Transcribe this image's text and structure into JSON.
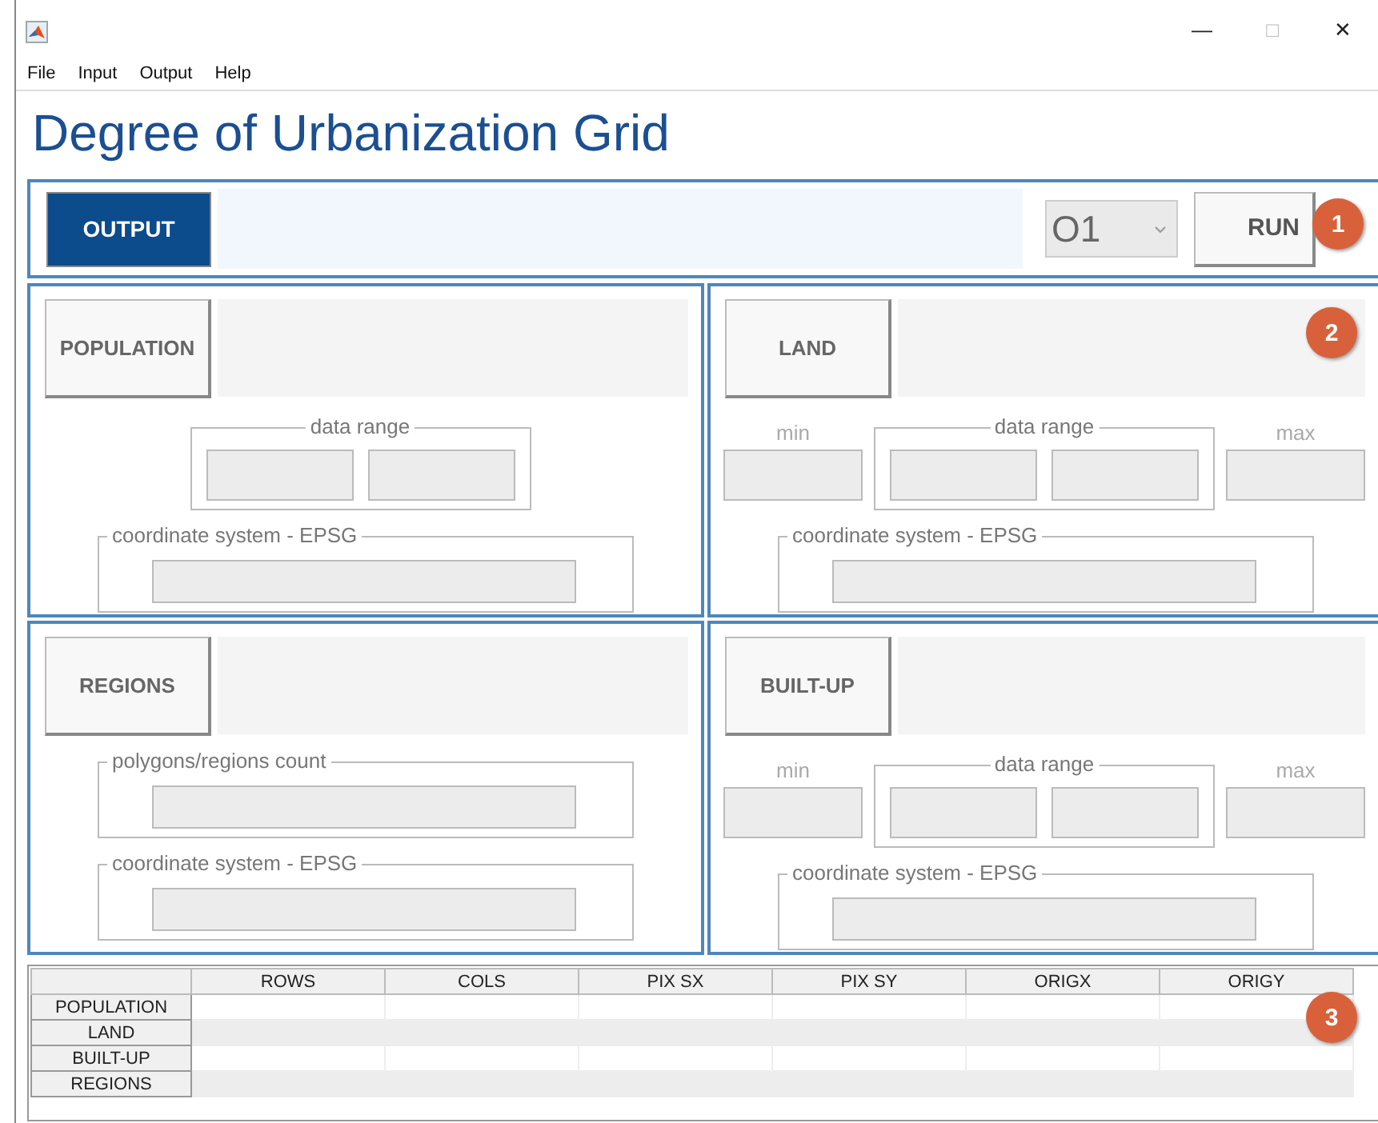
{
  "window": {
    "controls": [
      {
        "label": "—",
        "disabled": false
      },
      {
        "label": "□",
        "disabled": true
      },
      {
        "label": "✕",
        "disabled": false
      }
    ]
  },
  "menu": [
    "File",
    "Input",
    "Output",
    "Help"
  ],
  "title": "Degree of Urbanization Grid",
  "output_bar": {
    "button": "OUTPUT",
    "dropdown": {
      "value": "O1"
    },
    "run": "RUN"
  },
  "panels": [
    {
      "kind": "plain",
      "button": "POPULATION",
      "groups": [
        {
          "kind": "pair",
          "label": "data range"
        },
        {
          "kind": "single",
          "label": "coordinate system - EPSG"
        }
      ]
    },
    {
      "kind": "minmax",
      "button": "LAND",
      "min_label": "min",
      "max_label": "max",
      "groups": [
        {
          "kind": "pair",
          "label": "data range"
        },
        {
          "kind": "single",
          "label": "coordinate system - EPSG"
        }
      ]
    },
    {
      "kind": "plain",
      "button": "REGIONS",
      "groups": [
        {
          "kind": "single",
          "label": "polygons/regions count"
        },
        {
          "kind": "single",
          "label": "coordinate system - EPSG"
        }
      ]
    },
    {
      "kind": "minmax",
      "button": "BUILT-UP",
      "min_label": "min",
      "max_label": "max",
      "groups": [
        {
          "kind": "pair",
          "label": "data range"
        },
        {
          "kind": "single",
          "label": "coordinate system - EPSG"
        }
      ]
    }
  ],
  "table": {
    "columns": [
      "ROWS",
      "COLS",
      "PIX SX",
      "PIX SY",
      "ORIGX",
      "ORIGY"
    ],
    "rows": [
      {
        "label": "POPULATION"
      },
      {
        "label": "LAND"
      },
      {
        "label": "BUILT-UP"
      },
      {
        "label": "REGIONS"
      }
    ]
  },
  "callouts": [
    {
      "label": "1"
    },
    {
      "label": "2"
    },
    {
      "label": "3"
    }
  ]
}
